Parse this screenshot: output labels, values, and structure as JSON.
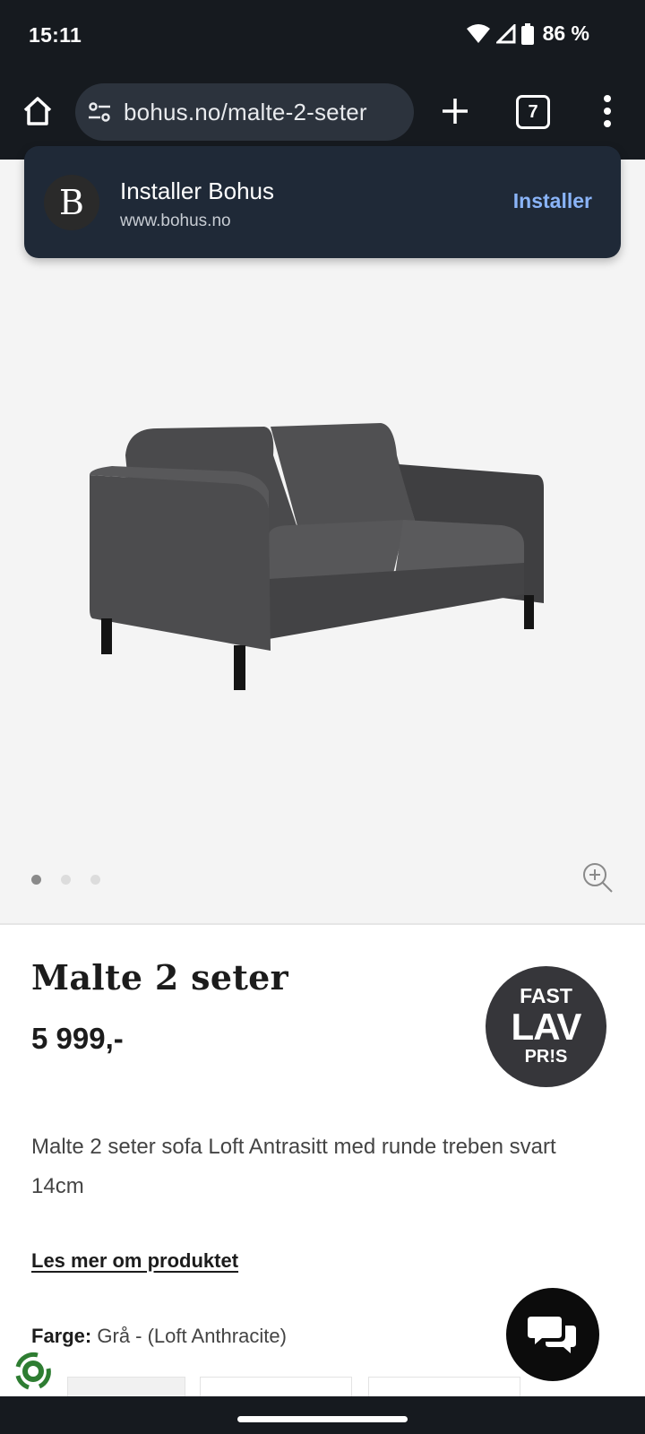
{
  "status_bar": {
    "time": "15:11",
    "battery": "86 %",
    "icons": [
      "wifi-icon",
      "cell-signal-icon",
      "battery-icon"
    ]
  },
  "browser": {
    "url": "bohus.no/malte-2-seter",
    "tab_count": "7",
    "icons": [
      "home-icon",
      "site-settings-icon",
      "plus-icon",
      "tabs-icon",
      "more-vert-icon"
    ]
  },
  "install_banner": {
    "logo_letter": "B",
    "title": "Installer Bohus",
    "url": "www.bohus.no",
    "button": "Installer"
  },
  "gallery": {
    "image": "sofa-image",
    "dots_total": 3,
    "active_dot": 1
  },
  "product": {
    "title": "Malte 2 seter",
    "price": "5 999,-",
    "badge": {
      "top": "FAST",
      "middle": "LAV",
      "bottom": "PR!S"
    },
    "description": "Malte 2 seter sofa Loft Antrasitt med runde treben svart 14cm",
    "read_more": "Les mer om produktet",
    "color_label": "Farge:",
    "color_value": "Grå - (Loft Anthracite)"
  },
  "colors": {
    "status_bg": "#161a1f",
    "banner_bg": "#1f2937",
    "install_accent": "#8ab4f8",
    "badge_bg": "#36363a",
    "gallery_bg": "#f4f4f4"
  }
}
